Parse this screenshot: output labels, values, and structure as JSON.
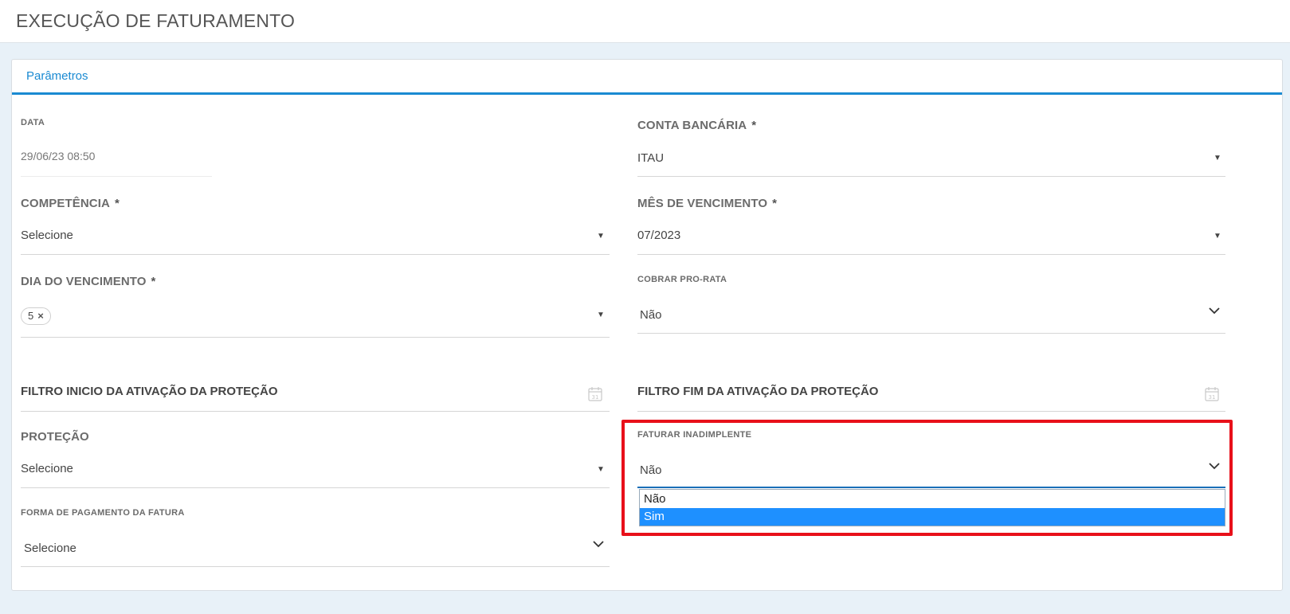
{
  "header": {
    "title": "EXECUÇÃO DE FATURAMENTO"
  },
  "tabs": [
    {
      "label": "Parâmetros"
    }
  ],
  "form": {
    "data": {
      "label": "DATA",
      "value": "29/06/23 08:50"
    },
    "conta_bancaria": {
      "label": "CONTA BANCÁRIA",
      "required": "*",
      "value": "ITAU"
    },
    "competencia": {
      "label": "COMPETÊNCIA",
      "required": "*",
      "value": "Selecione"
    },
    "mes_vencimento": {
      "label": "MÊS DE VENCIMENTO",
      "required": "*",
      "value": "07/2023"
    },
    "dia_vencimento": {
      "label": "DIA DO VENCIMENTO",
      "required": "*",
      "chips": [
        "5"
      ],
      "chip_remove": "×"
    },
    "cobrar_pro_rata": {
      "label": "COBRAR PRO-RATA",
      "value": "Não"
    },
    "filtro_inicio": {
      "label": "FILTRO INICIO DA ATIVAÇÃO DA PROTEÇÃO"
    },
    "filtro_fim": {
      "label": "FILTRO FIM DA ATIVAÇÃO DA PROTEÇÃO"
    },
    "protecao": {
      "label": "PROTEÇÃO",
      "value": "Selecione"
    },
    "faturar_inadimplente": {
      "label": "FATURAR INADIMPLENTE",
      "value": "Não",
      "options": [
        "Não",
        "Sim"
      ],
      "highlighted_option": "Sim"
    },
    "forma_pagamento": {
      "label": "FORMA DE PAGAMENTO DA FATURA",
      "value": "Selecione"
    }
  },
  "calendar_icon_day": "31",
  "colors": {
    "accent": "#1a8ad2",
    "highlight_border": "#e8101a",
    "selected_option": "#1e90ff"
  }
}
